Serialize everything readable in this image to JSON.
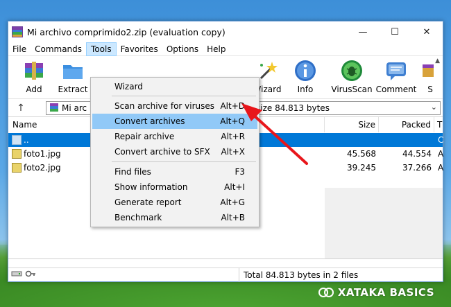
{
  "window": {
    "title": "Mi archivo comprimido2.zip (evaluation copy)",
    "controls": {
      "minimize": "—",
      "maximize": "☐",
      "close": "✕"
    }
  },
  "menubar": [
    "File",
    "Commands",
    "Tools",
    "Favorites",
    "Options",
    "Help"
  ],
  "toolbar": {
    "add": "Add",
    "extract": "Extract",
    "wizard": "Wizard",
    "info": "Info",
    "virusscan": "VirusScan",
    "comment": "Comment",
    "sfx": "S",
    "scroll_arrow": "▲"
  },
  "addressbar": {
    "up": "↑",
    "path": "Mi arc",
    "info": "size 84.813 bytes",
    "dropdown": "⌄"
  },
  "columns": {
    "name": "Name",
    "size": "Size",
    "packed": "Packed",
    "type": "T"
  },
  "files": [
    {
      "name": "..",
      "size": "",
      "packed": "",
      "type": "C"
    },
    {
      "name": "foto1.jpg",
      "size": "45.568",
      "packed": "44.554",
      "type": "A"
    },
    {
      "name": "foto2.jpg",
      "size": "39.245",
      "packed": "37.266",
      "type": "A"
    }
  ],
  "tools_menu": [
    {
      "label": "Wizard",
      "accel": ""
    },
    {
      "label": "Scan archive for viruses",
      "accel": "Alt+D"
    },
    {
      "label": "Convert archives",
      "accel": "Alt+Q"
    },
    {
      "label": "Repair archive",
      "accel": "Alt+R"
    },
    {
      "label": "Convert archive to SFX",
      "accel": "Alt+X"
    },
    {
      "label": "Find files",
      "accel": "F3"
    },
    {
      "label": "Show information",
      "accel": "Alt+I"
    },
    {
      "label": "Generate report",
      "accel": "Alt+G"
    },
    {
      "label": "Benchmark",
      "accel": "Alt+B"
    }
  ],
  "status": {
    "text": "Total 84.813 bytes in 2 files"
  },
  "watermark": {
    "text": "XATAKA BASICS"
  },
  "colors": {
    "accent": "#0078d7",
    "highlight": "#91c9f7",
    "arrow": "#e8161b"
  }
}
